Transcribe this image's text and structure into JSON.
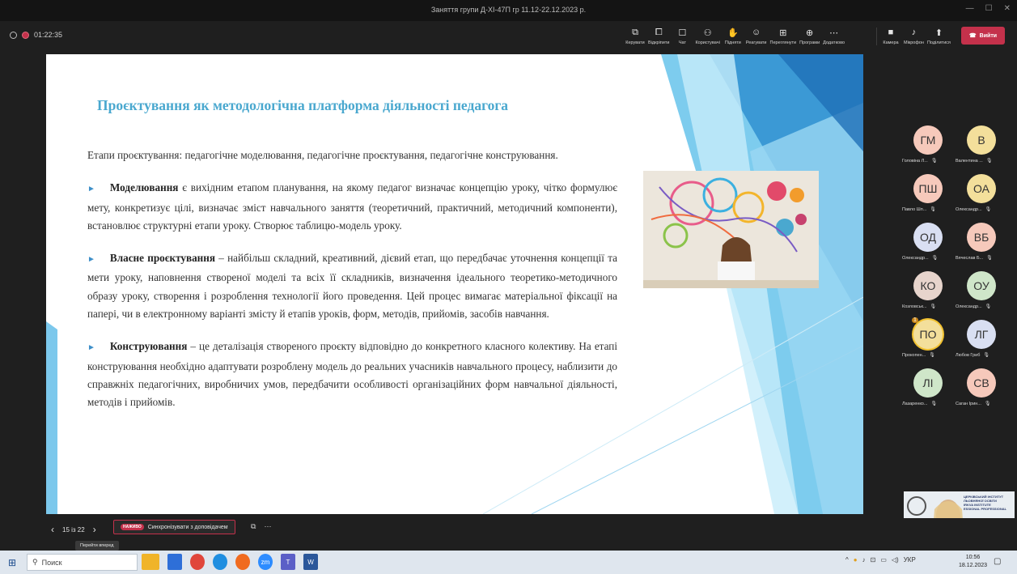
{
  "window": {
    "title": "Заняття групи Д-ХІ-47П гр 11.12-22.12.2023 р.",
    "min": "—",
    "max": "☐",
    "close": "✕"
  },
  "meeting": {
    "timer": "01:22:35",
    "toolbar": [
      {
        "icon": "share-tray-icon",
        "glyph": "⧉",
        "label": "Керувати"
      },
      {
        "icon": "popout-icon",
        "glyph": "⧠",
        "label": "Відкріпити"
      },
      {
        "icon": "chat-icon",
        "glyph": "☐",
        "label": "Чат"
      },
      {
        "icon": "people-icon",
        "glyph": "⚇",
        "label": "Користувачі"
      },
      {
        "icon": "raise-hand-icon",
        "glyph": "✋",
        "label": "Підняти"
      },
      {
        "icon": "react-icon",
        "glyph": "☺",
        "label": "Реагувати"
      },
      {
        "icon": "view-icon",
        "glyph": "⊞",
        "label": "Переглянути"
      },
      {
        "icon": "apps-icon",
        "glyph": "⊕",
        "label": "Програми"
      },
      {
        "icon": "more-icon",
        "glyph": "⋯",
        "label": "Додатково"
      }
    ],
    "media": [
      {
        "icon": "camera-icon",
        "glyph": "■",
        "label": "Камера"
      },
      {
        "icon": "microphone-icon",
        "glyph": "♪",
        "label": "Мікрофон"
      },
      {
        "icon": "share-icon",
        "glyph": "⬆",
        "label": "Поділитися"
      }
    ],
    "leave_label": "Вийти",
    "leave_color": "#c4314b"
  },
  "slide": {
    "title": "Проєктування як методологічна платформа діяльності педагога",
    "intro": "Етапи проєктування: педагогічне моделювання, педагогічне проєктування, педагогічне конструювання.",
    "items": [
      {
        "term": "Моделювання",
        "text": " є вихідним етапом планування, на якому педагог визначає концепцію уроку, чітко формулює мету, конкретизує цілі, визначає зміст навчального заняття (теоретичний, практичний, методичний компоненти), встановлює структурні етапи уроку. Створює таблицю-модель уроку."
      },
      {
        "term": "Власне проєктування",
        "text": " – найбільш складний, креативний, дієвий етап, що передбачає уточнення концепції та мети уроку, наповнення створеної моделі та всіх її складників, визначення ідеального теоретико-методичного образу уроку, створення і розроблення технології його проведення. Цей процес вимагає матеріальної фіксації на папері, чи в електронному варіанті змісту й етапів уроків, форм, методів, прийомів, засобів навчання."
      },
      {
        "term": "Конструювання",
        "text": " – це деталізація створеного проєкту відповідно до конкретного класного колективу. На етапі конструювання необхідно адаптувати розроблену модель до реальних учасників навчального процесу, наблизити до справжніх педагогічних, виробничих умов, передбачити особливості організаційних форм навчальної діяльності, методів і прийомів."
      }
    ],
    "accent": "#4aa8cf"
  },
  "participants": [
    {
      "initials": "ГМ",
      "name": "Головіна Л...",
      "color": "#f6c9bb"
    },
    {
      "initials": "В",
      "name": "Валентина ...",
      "color": "#f3df9b"
    },
    {
      "initials": "ПШ",
      "name": "Павло Шп...",
      "color": "#f6c9bb"
    },
    {
      "initials": "ОА",
      "name": "Олександр...",
      "color": "#f3df9b"
    },
    {
      "initials": "ОД",
      "name": "Олександр...",
      "color": "#d9dff2"
    },
    {
      "initials": "ВБ",
      "name": "Вячеслав Б...",
      "color": "#f6c9bb"
    },
    {
      "initials": "КО",
      "name": "Козловськ...",
      "color": "#e7d4cc"
    },
    {
      "initials": "ОУ",
      "name": "Олександр...",
      "color": "#cfe6c9"
    },
    {
      "initials": "ПО",
      "name": "Прокопен...",
      "color": "#f3df9b",
      "hand": "1"
    },
    {
      "initials": "ЛГ",
      "name": "Любов Гриб",
      "color": "#d9dff2"
    },
    {
      "initials": "ЛІ",
      "name": "Лазаренко...",
      "color": "#cfe6c9"
    },
    {
      "initials": "СВ",
      "name": "Саган Ірин...",
      "color": "#f6c9bb"
    }
  ],
  "self_view": {
    "banner_line1": "ЦЕРКІВСЬКИЙ ІНСТИТУТ",
    "banner_line2": "ЛЬОВНЯНОЇ ОСВІТИ",
    "banner_line3": "IRKVA INSTITUTE",
    "banner_line4": "ESSIONAL PROFESSIONAL"
  },
  "presenter": {
    "page": "15 із 22",
    "prev": "‹",
    "next": "›",
    "live_badge": "НАЖИВО",
    "sync_label": "Синхронізувати з доповідачем",
    "tooltip": "Перейти вперед"
  },
  "taskbar": {
    "search_placeholder": "Поиск",
    "lang": "УКР",
    "time": "10:56",
    "date": "18.12.2023"
  }
}
